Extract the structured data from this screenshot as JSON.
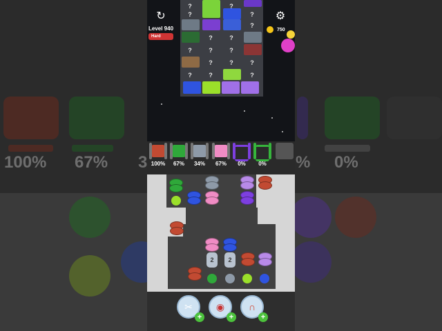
{
  "header": {
    "level_label": "Level 940",
    "difficulty": "Hard",
    "coins": "750"
  },
  "icons": {
    "restart": "restart-icon",
    "settings": "gear-icon",
    "coin": "coin-icon"
  },
  "board": {
    "question_mark": "?",
    "columns": [
      [
        "?",
        "?",
        "fabric",
        "?",
        "?",
        "?"
      ],
      [
        "fabric",
        "fabric",
        "?",
        "?",
        "?",
        "fabric"
      ],
      [
        "?",
        "fabric",
        "fabric",
        "?",
        "?",
        "?"
      ],
      [
        "fabric",
        "?",
        "?",
        "fabric",
        "?",
        "?"
      ]
    ],
    "bottom_fabrics": [
      "blue",
      "lime",
      "violet",
      "violet"
    ]
  },
  "spools": [
    {
      "color": "#c24a32",
      "percent": "100%"
    },
    {
      "color": "#2fa83a",
      "percent": "67%"
    },
    {
      "color": "#8e9aa8",
      "percent": "34%"
    },
    {
      "color": "#f08cc4",
      "percent": "67%"
    },
    {
      "color": "#7d3fe0",
      "percent": "0%"
    },
    {
      "color": "#36b53c",
      "percent": "0%"
    }
  ],
  "background": {
    "left_percents": [
      "100%",
      "67%",
      "3"
    ],
    "right_percents": [
      "%",
      "0%"
    ]
  },
  "grid": {
    "locked_counts": [
      "2",
      "2"
    ]
  },
  "boosters": [
    {
      "name": "scissors",
      "icon": "scissors-icon",
      "plus": "+"
    },
    {
      "name": "thread",
      "icon": "thread-spool-icon",
      "plus": "+"
    },
    {
      "name": "magnet",
      "icon": "magnet-icon",
      "plus": "+"
    }
  ],
  "colors": {
    "red": "#c24a32",
    "green": "#2fa83a",
    "gray": "#8e9aa8",
    "pink": "#f08cc4",
    "purple": "#7d3fe0",
    "lime": "#9be02a",
    "blue": "#2f54e0",
    "lavender": "#b88ae8"
  }
}
